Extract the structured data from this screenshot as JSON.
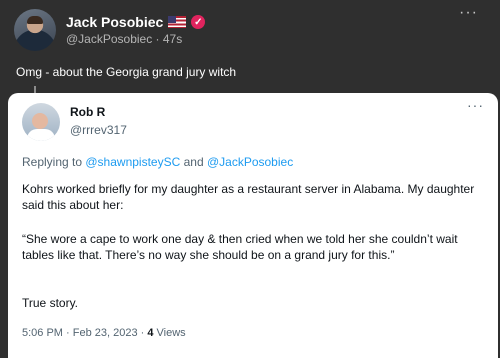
{
  "outer": {
    "name": "Jack Posobiec",
    "handle_time": "@JackPosobiec · 47s",
    "text": "Omg - about the Georgia grand jury witch",
    "more": "···"
  },
  "quote": {
    "name": "Rob R",
    "handle": "@rrrev317",
    "more": "···",
    "replying_prefix": "Replying to ",
    "mention1": "@shawnpisteySC",
    "and_word": " and ",
    "mention2": "@JackPosobiec",
    "p1": "Kohrs worked briefly for my daughter as a restaurant server in Alabama. My daughter said this about her:",
    "p2": "“She wore a cape to work one day & then cried when we told her she couldn’t wait tables like that.  There’s no way she should be on a grand jury for this.”",
    "p3": "True story.",
    "timestamp": "5:06 PM · Feb 23, 2023 · ",
    "views_count": "4",
    "views_label": " Views"
  },
  "icons": {
    "flag": "us-flag-icon",
    "verified": "verified-badge-icon"
  },
  "colors": {
    "background": "#2f2f2f",
    "card": "#ffffff",
    "link": "#1d9bf0",
    "badge": "#e0245e"
  }
}
